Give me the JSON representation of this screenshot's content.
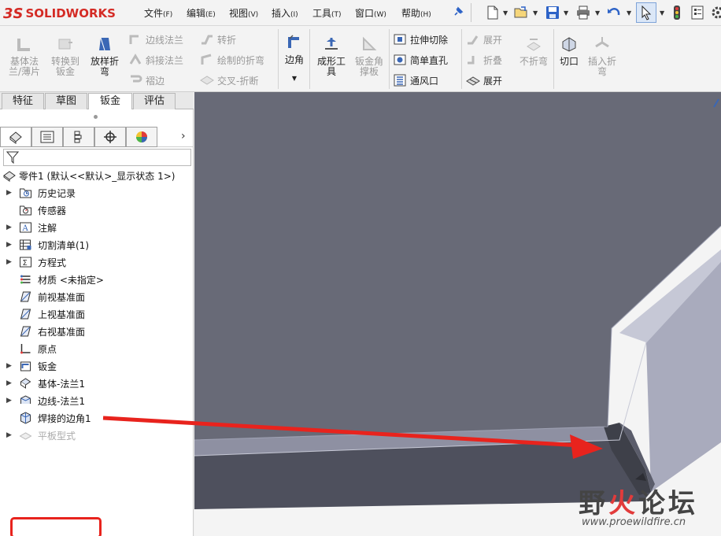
{
  "app": {
    "logo_ds": "3S",
    "logo_text": "SOLIDWORKS"
  },
  "menu": [
    {
      "label": "文件",
      "acc": "(F)"
    },
    {
      "label": "编辑",
      "acc": "(E)"
    },
    {
      "label": "视图",
      "acc": "(V)"
    },
    {
      "label": "插入",
      "acc": "(I)"
    },
    {
      "label": "工具",
      "acc": "(T)"
    },
    {
      "label": "窗口",
      "acc": "(W)"
    },
    {
      "label": "帮助",
      "acc": "(H)"
    }
  ],
  "toolbar_icons": [
    "new-file-icon",
    "open-file-icon",
    "save-icon",
    "print-icon",
    "undo-icon",
    "select-cursor-icon",
    "traffic-light-icon",
    "options-icon"
  ],
  "ribbon": {
    "base_flange": "基体法\n兰/薄片",
    "convert_sheet": "转换到\n钣金",
    "lofted_bend": "放样折\n弯",
    "edge_flange": "边线法兰",
    "miter_flange": "斜接法兰",
    "hem": "褶边",
    "jog": "转折",
    "sketched_bend": "绘制的折弯",
    "cross_break": "交叉-折断",
    "corners": "边角",
    "forming_tool": "成形工\n具",
    "gusset": "钣金角\n撑板",
    "extruded_cut": "拉伸切除",
    "simple_hole": "简单直孔",
    "vent": "通风口",
    "unfold": "展开",
    "fold": "折叠",
    "flatten": "展开",
    "no_bends": "不折弯",
    "rip": "切口",
    "insert_bends": "插入折\n弯"
  },
  "cm_tabs": [
    {
      "label": "特征",
      "active": false
    },
    {
      "label": "草图",
      "active": false
    },
    {
      "label": "钣金",
      "active": true
    },
    {
      "label": "评估",
      "active": false
    }
  ],
  "panel_tab_icons": [
    "feature-manager-icon",
    "property-manager-icon",
    "configuration-manager-icon",
    "dimxpert-icon",
    "display-manager-icon"
  ],
  "tree": {
    "root": "零件1  (默认<<默认>_显示状态 1>)",
    "items": [
      {
        "label": "历史记录",
        "expandable": true,
        "icon": "history-folder-icon",
        "dim": false
      },
      {
        "label": "传感器",
        "expandable": false,
        "icon": "sensor-folder-icon",
        "dim": false
      },
      {
        "label": "注解",
        "expandable": true,
        "icon": "annotations-icon",
        "dim": false
      },
      {
        "label": "切割清单(1)",
        "expandable": true,
        "icon": "cut-list-icon",
        "dim": false
      },
      {
        "label": "方程式",
        "expandable": true,
        "icon": "equations-icon",
        "dim": false
      },
      {
        "label": "材质 <未指定>",
        "expandable": false,
        "icon": "material-icon",
        "dim": false
      },
      {
        "label": "前视基准面",
        "expandable": false,
        "icon": "plane-icon",
        "dim": false
      },
      {
        "label": "上视基准面",
        "expandable": false,
        "icon": "plane-icon",
        "dim": false
      },
      {
        "label": "右视基准面",
        "expandable": false,
        "icon": "plane-icon",
        "dim": false
      },
      {
        "label": "原点",
        "expandable": false,
        "icon": "origin-icon",
        "dim": false
      },
      {
        "label": "钣金",
        "expandable": true,
        "icon": "sheet-metal-folder-icon",
        "dim": false
      },
      {
        "label": "基体-法兰1",
        "expandable": true,
        "icon": "base-flange-feature-icon",
        "dim": false
      },
      {
        "label": "边线-法兰1",
        "expandable": true,
        "icon": "edge-flange-feature-icon",
        "dim": false
      },
      {
        "label": "焊接的边角1",
        "expandable": false,
        "icon": "welded-corner-feature-icon",
        "dim": false
      },
      {
        "label": "平板型式",
        "expandable": true,
        "icon": "flat-pattern-icon",
        "dim": true
      }
    ]
  },
  "colors": {
    "highlight": "#e8231d",
    "part_face": "#6a6c7a",
    "part_edge": "#9fa2b4",
    "accent_blue": "#3b6fc4"
  },
  "watermark": {
    "title_a": "野",
    "title_b": "火",
    "title_c": "论坛",
    "url": "www.proewildfire.cn"
  }
}
